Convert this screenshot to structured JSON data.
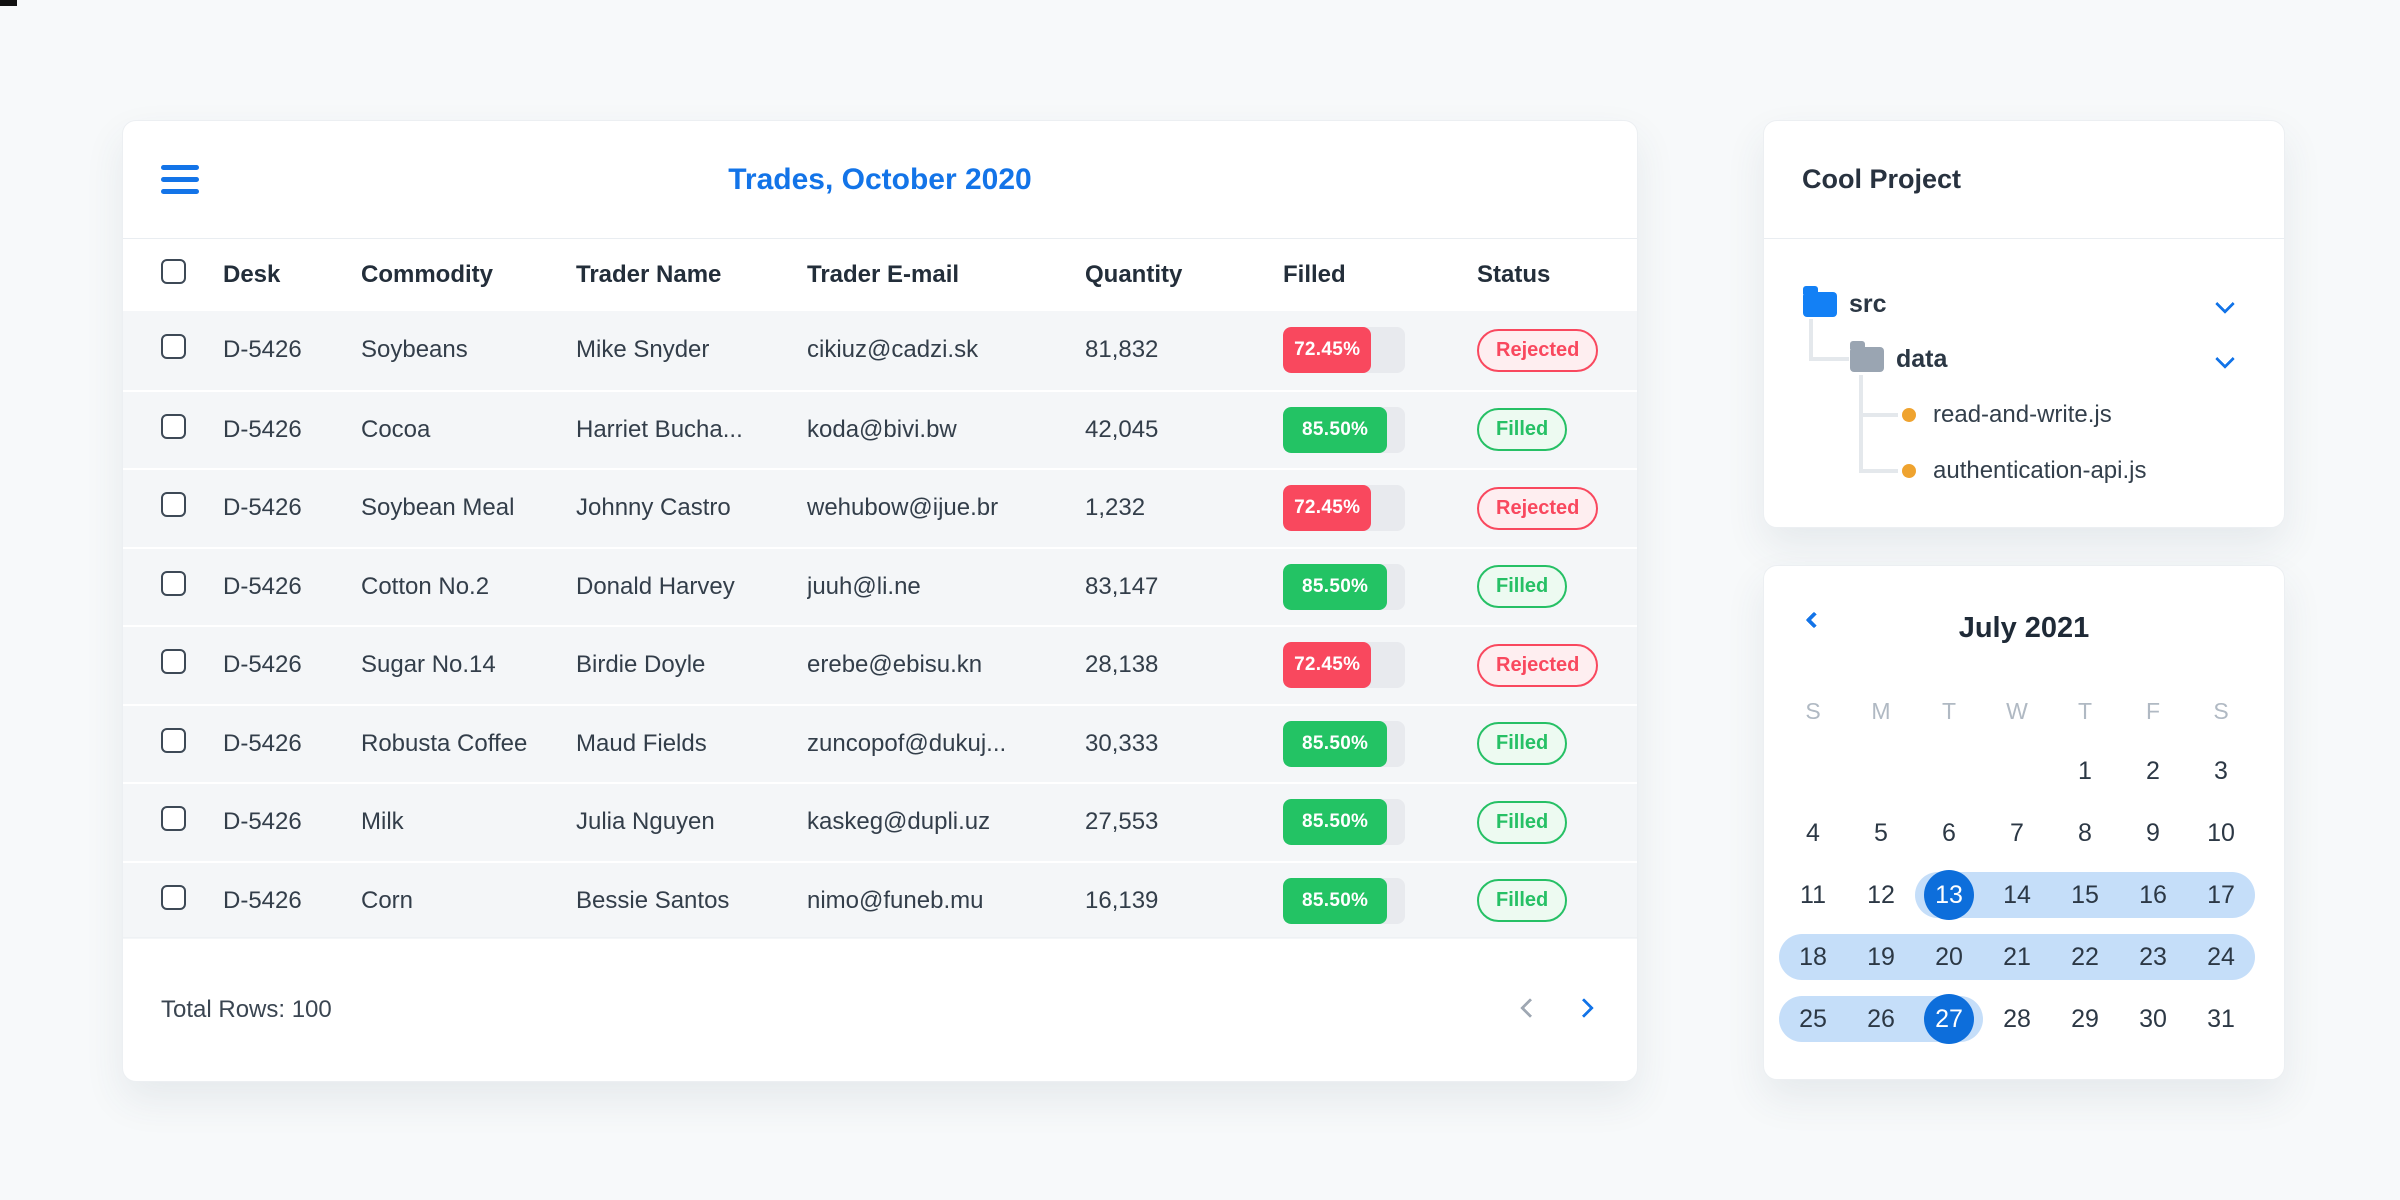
{
  "table_card": {
    "title": "Trades, October 2020",
    "columns": [
      "Desk",
      "Commodity",
      "Trader Name",
      "Trader E-mail",
      "Quantity",
      "Filled",
      "Status"
    ],
    "rows": [
      {
        "desk": "D-5426",
        "commodity": "Soybeans",
        "trader": "Mike Snyder",
        "email": "cikiuz@cadzi.sk",
        "quantity": "81,832",
        "filled_pct": "72.45%",
        "filled_value": 72.45,
        "status": "Rejected"
      },
      {
        "desk": "D-5426",
        "commodity": "Cocoa",
        "trader": "Harriet Bucha...",
        "email": "koda@bivi.bw",
        "quantity": "42,045",
        "filled_pct": "85.50%",
        "filled_value": 85.5,
        "status": "Filled"
      },
      {
        "desk": "D-5426",
        "commodity": "Soybean Meal",
        "trader": "Johnny Castro",
        "email": "wehubow@ijue.br",
        "quantity": "1,232",
        "filled_pct": "72.45%",
        "filled_value": 72.45,
        "status": "Rejected"
      },
      {
        "desk": "D-5426",
        "commodity": "Cotton No.2",
        "trader": "Donald Harvey",
        "email": "juuh@li.ne",
        "quantity": "83,147",
        "filled_pct": "85.50%",
        "filled_value": 85.5,
        "status": "Filled"
      },
      {
        "desk": "D-5426",
        "commodity": "Sugar No.14",
        "trader": "Birdie Doyle",
        "email": "erebe@ebisu.kn",
        "quantity": "28,138",
        "filled_pct": "72.45%",
        "filled_value": 72.45,
        "status": "Rejected"
      },
      {
        "desk": "D-5426",
        "commodity": "Robusta Coffee",
        "trader": "Maud Fields",
        "email": "zuncopof@dukuj...",
        "quantity": "30,333",
        "filled_pct": "85.50%",
        "filled_value": 85.5,
        "status": "Filled"
      },
      {
        "desk": "D-5426",
        "commodity": "Milk",
        "trader": "Julia Nguyen",
        "email": "kaskeg@dupli.uz",
        "quantity": "27,553",
        "filled_pct": "85.50%",
        "filled_value": 85.5,
        "status": "Filled"
      },
      {
        "desk": "D-5426",
        "commodity": "Corn",
        "trader": "Bessie Santos",
        "email": "nimo@funeb.mu",
        "quantity": "16,139",
        "filled_pct": "85.50%",
        "filled_value": 85.5,
        "status": "Filled"
      }
    ],
    "footer": {
      "total_label": "Total Rows: 100"
    },
    "status_colors": {
      "Rejected": "#f9485e",
      "Filled": "#23c364"
    }
  },
  "file_panel": {
    "title": "Cool Project",
    "tree": [
      {
        "label": "src",
        "type": "folder",
        "color": "blue",
        "expanded": true
      },
      {
        "label": "data",
        "type": "folder",
        "color": "gray",
        "expanded": true
      },
      {
        "label": "read-and-write.js",
        "type": "file",
        "marker": "orange-dot"
      },
      {
        "label": "authentication-api.js",
        "type": "file",
        "marker": "orange-dot"
      }
    ]
  },
  "calendar": {
    "month_label": "July 2021",
    "day_headers": [
      "S",
      "M",
      "T",
      "W",
      "T",
      "F",
      "S"
    ],
    "selected_dates": [
      13,
      27
    ],
    "range": {
      "start": 13,
      "end": 27
    },
    "weeks": [
      [
        {
          "d": ""
        },
        {
          "d": ""
        },
        {
          "d": ""
        },
        {
          "d": ""
        },
        {
          "d": 1
        },
        {
          "d": 2
        },
        {
          "d": 3
        }
      ],
      [
        {
          "d": 4
        },
        {
          "d": 5
        },
        {
          "d": 6
        },
        {
          "d": 7
        },
        {
          "d": 8
        },
        {
          "d": 9
        },
        {
          "d": 10
        }
      ],
      [
        {
          "d": 11
        },
        {
          "d": 12
        },
        {
          "d": 13,
          "selected": true,
          "range": true,
          "capL": true
        },
        {
          "d": 14,
          "range": true
        },
        {
          "d": 15,
          "range": true
        },
        {
          "d": 16,
          "range": true
        },
        {
          "d": 17,
          "range": true,
          "capR": true
        }
      ],
      [
        {
          "d": 18,
          "range": true,
          "capL": true
        },
        {
          "d": 19,
          "range": true
        },
        {
          "d": 20,
          "range": true
        },
        {
          "d": 21,
          "range": true
        },
        {
          "d": 22,
          "range": true
        },
        {
          "d": 23,
          "range": true
        },
        {
          "d": 24,
          "range": true,
          "capR": true
        }
      ],
      [
        {
          "d": 25,
          "range": true,
          "capL": true
        },
        {
          "d": 26,
          "range": true
        },
        {
          "d": 27,
          "selected": true,
          "range": true,
          "capR": true
        },
        {
          "d": 28
        },
        {
          "d": 29
        },
        {
          "d": 30
        },
        {
          "d": 31
        }
      ]
    ]
  },
  "colors": {
    "accent_blue": "#1374e8",
    "selected_day_blue": "#0d6edb",
    "range_blue": "#c5def9",
    "red": "#f9485e",
    "green": "#23c364"
  }
}
